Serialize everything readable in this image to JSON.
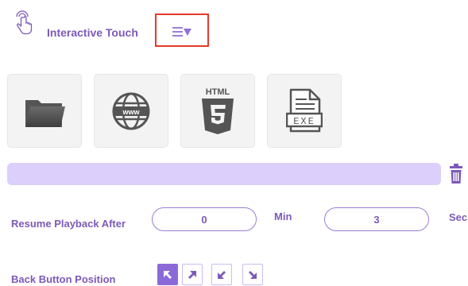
{
  "header": {
    "title": "Interactive Touch",
    "hand_icon": "touch-hand-icon",
    "menu_icon": "list-dropdown-icon"
  },
  "tiles": [
    {
      "name": "folder",
      "icon": "folder-icon"
    },
    {
      "name": "web",
      "icon": "globe-www-icon"
    },
    {
      "name": "html5",
      "icon": "html5-icon",
      "label": "HTML"
    },
    {
      "name": "exe",
      "icon": "exe-file-icon",
      "label": "EXE"
    }
  ],
  "selection": {
    "value": "",
    "delete_icon": "trash-icon"
  },
  "resume": {
    "label": "Resume Playback After",
    "min_value": "0",
    "min_unit": "Min",
    "sec_value": "3",
    "sec_unit": "Sec"
  },
  "back_button": {
    "label": "Back Button Position",
    "positions": [
      {
        "name": "top-left",
        "selected": true
      },
      {
        "name": "top-right",
        "selected": false
      },
      {
        "name": "bottom-left",
        "selected": false
      },
      {
        "name": "bottom-right",
        "selected": false
      }
    ]
  },
  "colors": {
    "accent": "#7c5ab8",
    "highlight_border": "#e53a2a",
    "selection_bar": "#dccffb"
  }
}
